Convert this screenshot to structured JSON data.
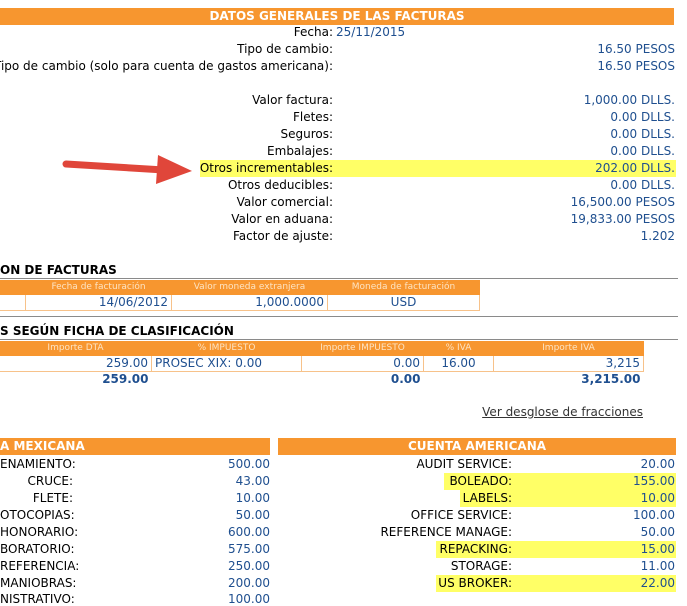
{
  "general": {
    "title": "DATOS GENERALES DE LAS FACTURAS",
    "rows": [
      {
        "label": "Fecha:",
        "value": "25/11/2015"
      },
      {
        "label": "Tipo de cambio:",
        "value": "16.50 PESOS"
      },
      {
        "label": "Tipo de cambio (solo para cuenta de gastos americana):",
        "value": "16.50 PESOS"
      },
      {
        "label": "Valor factura:",
        "value": "1,000.00 DLLS."
      },
      {
        "label": "Fletes:",
        "value": "0.00 DLLS."
      },
      {
        "label": "Seguros:",
        "value": "0.00 DLLS."
      },
      {
        "label": "Embalajes:",
        "value": "0.00 DLLS."
      },
      {
        "label": "Otros incrementables:",
        "value": "202.00 DLLS."
      },
      {
        "label": "Otros deducibles:",
        "value": "0.00 DLLS."
      },
      {
        "label": "Valor comercial:",
        "value": "16,500.00 PESOS"
      },
      {
        "label": "Valor en aduana:",
        "value": "19,833.00 PESOS"
      },
      {
        "label": "Factor de ajuste:",
        "value": "1.202"
      }
    ]
  },
  "facturas": {
    "title": "ON DE FACTURAS",
    "headers": [
      "Fecha de facturación",
      "Valor moneda extranjera",
      "Moneda de facturación"
    ],
    "row": [
      "14/06/2012",
      "1,000.0000",
      "USD"
    ]
  },
  "clasificacion": {
    "title": "S SEGÚN FICHA DE CLASIFICACIÓN",
    "headers": [
      "Importe DTA",
      "% IMPUESTO",
      "Importe IMPUESTO",
      "% IVA",
      "Importe IVA"
    ],
    "row": [
      "259.00",
      "PROSEC XIX: 0.00",
      "0.00",
      "16.00",
      "3,215"
    ],
    "totals": [
      "259.00",
      "0.00",
      "3,215.00"
    ],
    "link": "Ver desglose de fracciones"
  },
  "cuenta_mexicana": {
    "title": "A MEXICANA",
    "items": [
      {
        "label": "ENAMIENTO:",
        "value": "500.00"
      },
      {
        "label": "CRUCE:",
        "value": "43.00"
      },
      {
        "label": "FLETE:",
        "value": "10.00"
      },
      {
        "label": "OTOCOPIAS:",
        "value": "50.00"
      },
      {
        "label": "HONORARIO:",
        "value": "600.00"
      },
      {
        "label": "BORATORIO:",
        "value": "575.00"
      },
      {
        "label": "REFERENCIA:",
        "value": "250.00"
      },
      {
        "label": "MANIOBRAS:",
        "value": "200.00"
      },
      {
        "label": "NISTRATIVO:",
        "value": "100.00"
      }
    ]
  },
  "cuenta_americana": {
    "title": "CUENTA AMERICANA",
    "items": [
      {
        "label": "AUDIT SERVICE:",
        "value": "20.00"
      },
      {
        "label": "BOLEADO:",
        "value": "155.00"
      },
      {
        "label": "LABELS:",
        "value": "10.00"
      },
      {
        "label": "OFFICE SERVICE:",
        "value": "100.00"
      },
      {
        "label": "REFERENCE MANAGE:",
        "value": "50.00"
      },
      {
        "label": "REPACKING:",
        "value": "15.00"
      },
      {
        "label": "STORAGE:",
        "value": "11.00"
      },
      {
        "label": "US BROKER:",
        "value": "22.00"
      }
    ]
  },
  "colors": {
    "header": "#f7962f",
    "highlight": "#ffff66",
    "value_text": "#1f4f8f",
    "arrow": "#e0463a"
  }
}
